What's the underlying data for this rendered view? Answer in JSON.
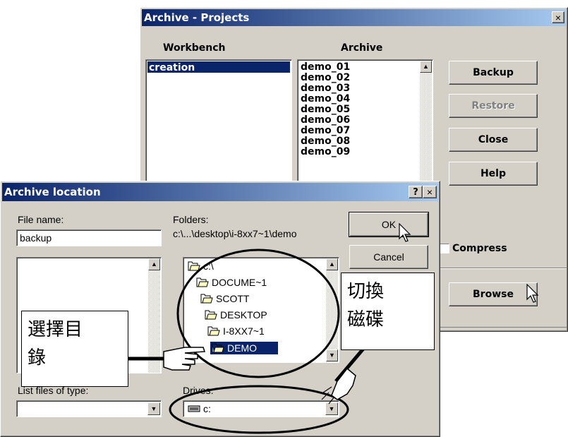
{
  "archive_projects": {
    "title": "Archive - Projects",
    "close_glyph": "×",
    "workbench_header": "Workbench",
    "archive_header": "Archive",
    "workbench_items": [
      "creation"
    ],
    "archive_items": [
      "demo_01",
      "demo_02",
      "demo_03",
      "demo_04",
      "demo_05",
      "demo_06",
      "demo_07",
      "demo_08",
      "demo_09"
    ],
    "buttons": {
      "backup": "Backup",
      "restore": "Restore",
      "close": "Close",
      "help": "Help",
      "browse": "Browse"
    },
    "compress_label": "Compress"
  },
  "archive_location": {
    "title": "Archive location",
    "help_glyph": "?",
    "close_glyph": "×",
    "file_name_label": "File name:",
    "file_name_value": "backup",
    "folders_label": "Folders:",
    "folders_path": "c:\\...\\desktop\\i-8xx7~1\\demo",
    "ok": "OK",
    "cancel": "Cancel",
    "folders": [
      "c:\\",
      "DOCUME~1",
      "SCOTT",
      "DESKTOP",
      "I-8XX7~1",
      "DEMO"
    ],
    "list_files_label": "List files of type:",
    "drives_label": "Drives:",
    "drive_value": "c:"
  },
  "annotations": {
    "select_dir": [
      "選擇目",
      "錄"
    ],
    "switch_disk": [
      "切換",
      "磁碟"
    ]
  },
  "colors": {
    "title_blue": "#0a246a",
    "title_light": "#a6caf0",
    "selection": "#0a246a",
    "face": "#d4d0c8"
  }
}
